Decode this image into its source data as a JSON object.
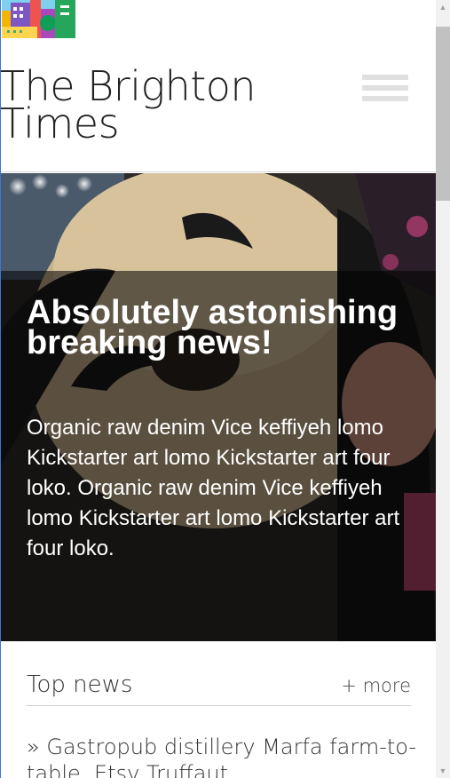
{
  "app": {
    "logo_icon": "city-buildings-logo-icon"
  },
  "header": {
    "title": "The Brighton Times",
    "menu_icon": "hamburger-menu-icon"
  },
  "hero": {
    "headline": "Absolutely astonishing breaking news!",
    "body": "Organic raw denim Vice keffiyeh lomo Kickstarter art lomo Kickstarter art four loko. Organic raw denim Vice keffiyeh lomo Kickstarter art lomo Kickstarter art four loko."
  },
  "top_news": {
    "title": "Top news",
    "more_label": "+ more",
    "items": [
      {
        "text": "» Gastropub distillery Marfa farm-to-table, Etsy Truffaut"
      }
    ]
  },
  "scrollbar": {
    "up_arrow": "▲",
    "down_arrow": "▼"
  },
  "colors": {
    "hero_overlay": "#000000",
    "menu_bars": "#e0e0e0",
    "scroll_thumb": "#c1c1c1"
  }
}
